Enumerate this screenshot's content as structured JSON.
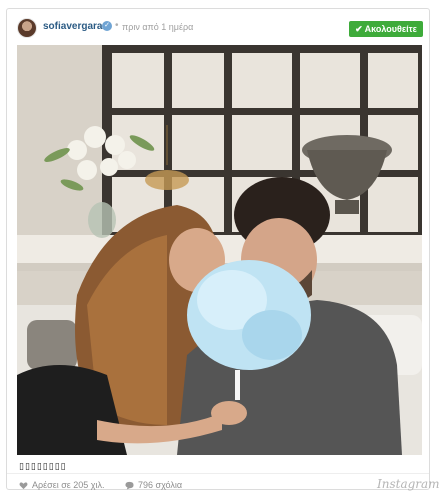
{
  "header": {
    "username": "sofiavergara",
    "verified_icon": "verified-badge-icon",
    "separator": "•",
    "timestamp": "πριν από 1 ημέρα",
    "follow_label": "Ακολουθείτε",
    "follow_icon": "checkmark-icon",
    "follow_color": "#3eab3a"
  },
  "post": {
    "image_content": "couple-photo-with-cotton-candy",
    "caption": "▯▯▯▯▯▯▯▯"
  },
  "footer": {
    "likes_label": "Αρέσει σε 205 χιλ.",
    "likes_icon": "heart-icon",
    "comments_label": "796 σχόλια",
    "comments_icon": "comment-bubble-icon",
    "brand": "Instagram"
  },
  "colors": {
    "username": "#2b5b84",
    "meta_text": "#8e8e8e"
  }
}
